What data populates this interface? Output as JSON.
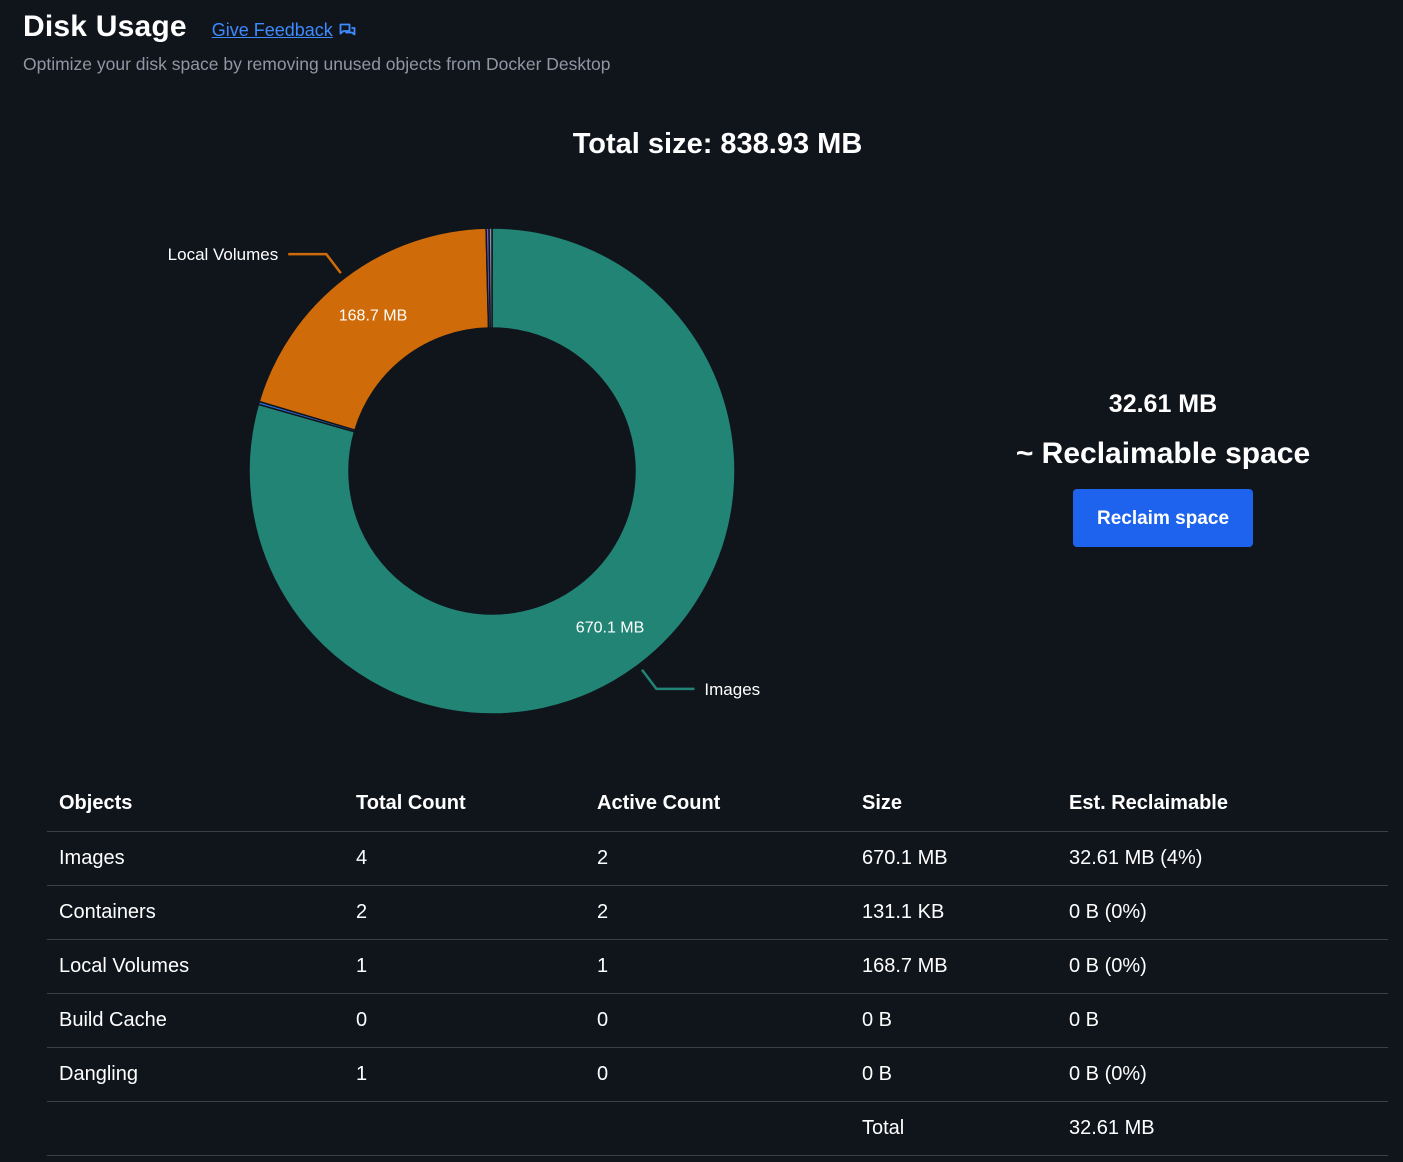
{
  "header": {
    "title": "Disk Usage",
    "feedback_label": "Give Feedback",
    "feedback_icon": "chat-bubbles-icon",
    "subtitle": "Optimize your disk space by removing unused objects from Docker Desktop"
  },
  "summary": {
    "total_size": "Total size: 838.93 MB",
    "reclaimable_value": "32.61 MB",
    "reclaimable_label": "~ Reclaimable space",
    "reclaim_button": "Reclaim space"
  },
  "chart_data": {
    "type": "pie",
    "variant": "donut",
    "title": "",
    "unit": "MB",
    "slices": [
      {
        "name": "Images",
        "value": 670.1,
        "value_label": "670.1 MB",
        "color": "#218475",
        "show_labels": true
      },
      {
        "name": "Containers",
        "value": 0.13,
        "value_label": "",
        "color": "#2d6cd8",
        "show_labels": false
      },
      {
        "name": "Local Volumes",
        "value": 168.7,
        "value_label": "168.7 MB",
        "color": "#cf6c09",
        "show_labels": true
      },
      {
        "name": "Build Cache",
        "value": 0,
        "value_label": "",
        "color": "#7b5cd6",
        "show_labels": false
      },
      {
        "name": "Dangling",
        "value": 0,
        "value_label": "",
        "color": "#8a93a6",
        "show_labels": false
      }
    ]
  },
  "table": {
    "headers": [
      "Objects",
      "Total Count",
      "Active Count",
      "Size",
      "Est. Reclaimable"
    ],
    "rows": [
      [
        "Images",
        "4",
        "2",
        "670.1 MB",
        "32.61 MB (4%)"
      ],
      [
        "Containers",
        "2",
        "2",
        "131.1 KB",
        "0 B (0%)"
      ],
      [
        "Local Volumes",
        "1",
        "1",
        "168.7 MB",
        "0 B (0%)"
      ],
      [
        "Build Cache",
        "0",
        "0",
        "0 B",
        "0 B"
      ],
      [
        "Dangling",
        "1",
        "0",
        "0 B",
        "0 B (0%)"
      ]
    ],
    "total_label": "Total",
    "total_value": "32.61 MB"
  },
  "colors": {
    "background": "#10151c",
    "accent": "#1d63ed",
    "link": "#3d8bff"
  }
}
